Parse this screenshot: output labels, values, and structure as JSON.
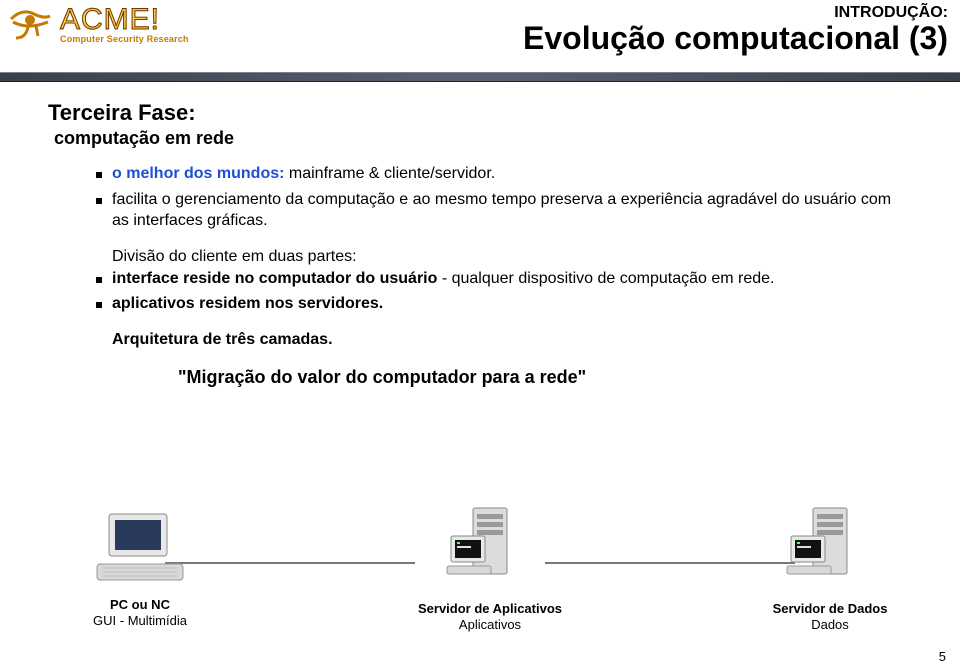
{
  "logo": {
    "main": "ACME!",
    "sub": "Computer Security Research"
  },
  "header": {
    "pretitle": "INTRODUÇÃO:",
    "title": "Evolução computacional (3)"
  },
  "phase": {
    "title": "Terceira Fase:",
    "subtitle": "computação em rede"
  },
  "bullet1": {
    "lead": "o melhor dos mundos:",
    "rest": " mainframe & cliente/servidor."
  },
  "bullet2": "facilita o gerenciamento da computação e ao mesmo tempo preserva a experiência agradável do usuário com as interfaces gráficas.",
  "division": {
    "heading": "Divisão do cliente em duas partes:",
    "item1a": "interface reside no computador do usuário",
    "item1b": " - qualquer dispositivo de computação em rede.",
    "item2": "aplicativos residem nos servidores."
  },
  "architecture": "Arquitetura de três camadas.",
  "quote": "\"Migração do valor do computador para a rede\"",
  "diagram": {
    "client": {
      "l1": "PC ou NC",
      "l2": "GUI - Multimídia"
    },
    "appserver": {
      "l1": "Servidor de Aplicativos",
      "l2": "Aplicativos"
    },
    "dataserver": {
      "l1": "Servidor de Dados",
      "l2": "Dados"
    }
  },
  "page": "5"
}
